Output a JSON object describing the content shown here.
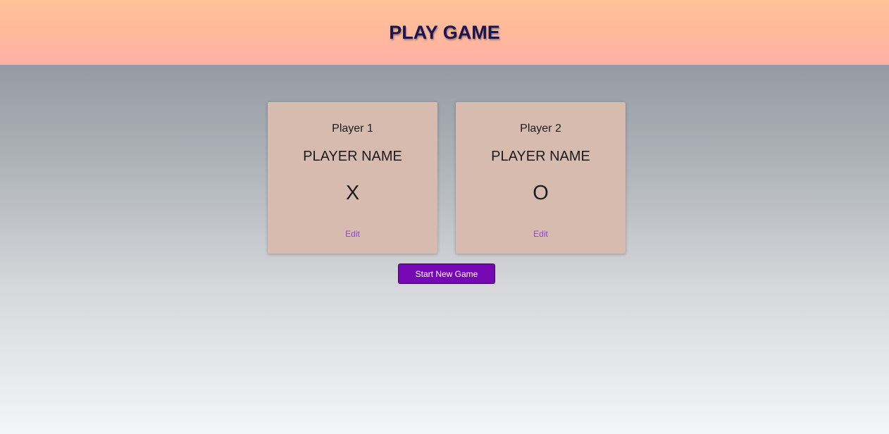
{
  "header": {
    "title": "PLAY GAME"
  },
  "players": [
    {
      "label": "Player 1",
      "name": "PLAYER NAME",
      "symbol": "X",
      "edit_label": "Edit"
    },
    {
      "label": "Player 2",
      "name": "PLAYER NAME",
      "symbol": "O",
      "edit_label": "Edit"
    }
  ],
  "actions": {
    "start_label": "Start New Game"
  },
  "colors": {
    "header_gradient_top": "#ffc296",
    "header_gradient_bottom": "#ffb0a4",
    "title": "#1a1450",
    "card": "#d6bbae",
    "link": "#8c43e2",
    "button": "#7608b4"
  }
}
